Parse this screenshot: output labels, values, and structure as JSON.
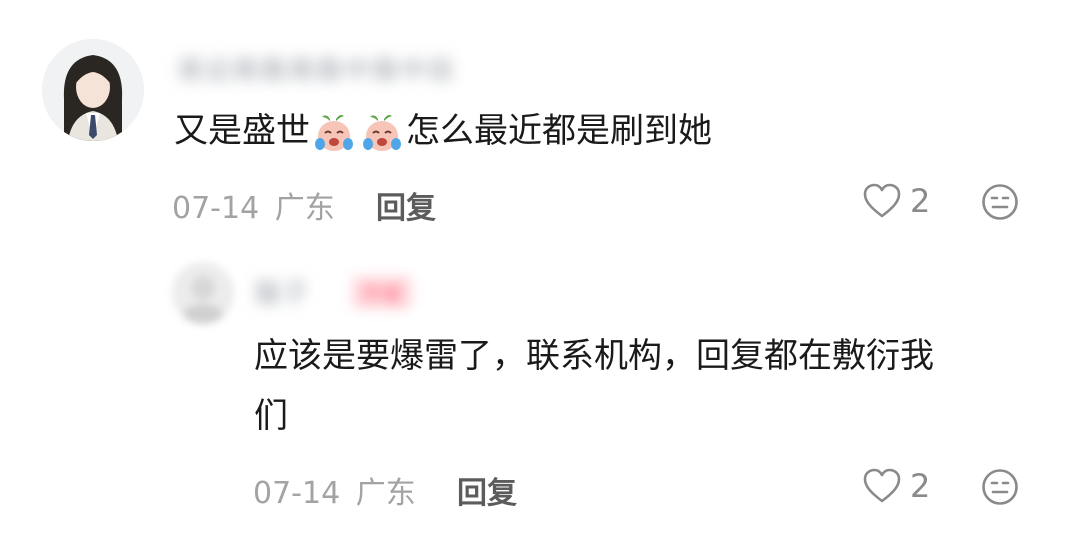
{
  "comment1": {
    "username": "清远南路南路中路中段",
    "text_before": "又是盛世",
    "emoji_1": "crying-face-emoji",
    "emoji_2": "crying-face-emoji",
    "text_after": "怎么最近都是刷到她",
    "date": "07-14",
    "location": "广东",
    "reply_label": "回复",
    "likes": "2"
  },
  "comment2": {
    "username": "猫子",
    "tag": "作者",
    "text_line1": "应该是要爆雷了，联系机构，回复都在敷衍我",
    "text_line2": "们",
    "date": "07-14",
    "location": "广东",
    "reply_label": "回复",
    "likes": "2"
  }
}
